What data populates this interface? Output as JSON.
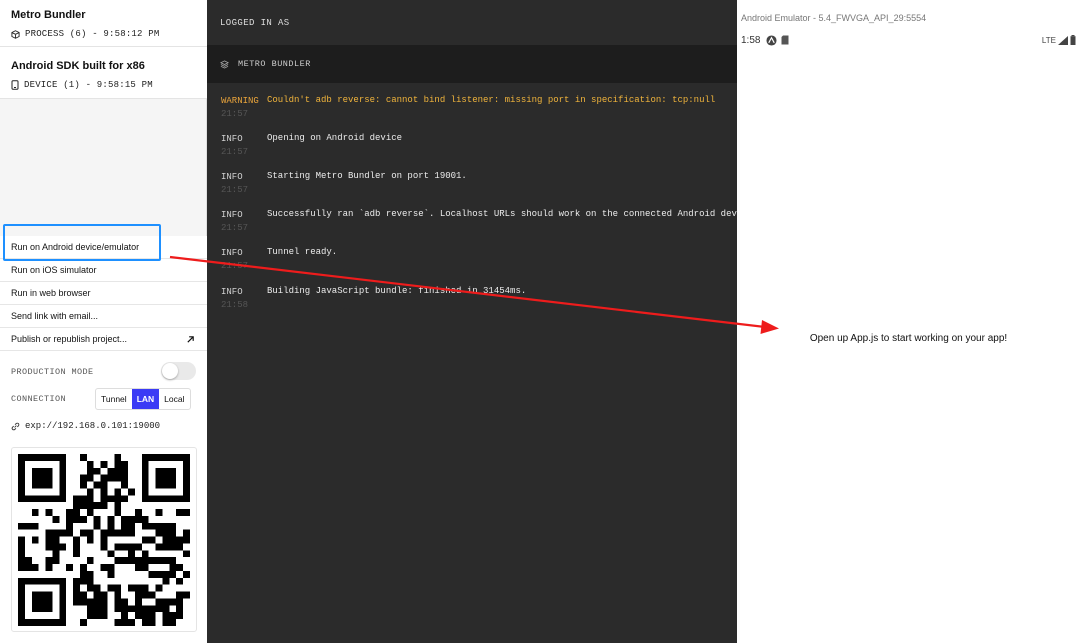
{
  "sidebar": {
    "processes": [
      {
        "title": "Metro Bundler",
        "subtitle": "PROCESS (6) - 9:58:12 PM"
      },
      {
        "title": "Android SDK built for x86",
        "subtitle": "DEVICE (1) - 9:58:15 PM"
      }
    ],
    "actions": [
      "Run on Android device/emulator",
      "Run on iOS simulator",
      "Run in web browser",
      "Send link with email...",
      "Publish or republish project..."
    ],
    "production_mode_label": "PRODUCTION MODE",
    "production_mode_on": false,
    "connection_label": "CONNECTION",
    "connection_options": [
      "Tunnel",
      "LAN",
      "Local"
    ],
    "connection_selected": "LAN",
    "exp_url": "exp://192.168.0.101:19000"
  },
  "logs": {
    "logged_in_label": "LOGGED IN AS",
    "panel_title": "METRO BUNDLER",
    "entries": [
      {
        "level": "WARNING",
        "time": "21:57",
        "message": "Couldn't adb reverse: cannot bind listener: missing port in specification: tcp:null"
      },
      {
        "level": "INFO",
        "time": "21:57",
        "message": "Opening on Android device"
      },
      {
        "level": "INFO",
        "time": "21:57",
        "message": "Starting Metro Bundler on port 19001."
      },
      {
        "level": "INFO",
        "time": "21:57",
        "message": "Successfully ran `adb reverse`. Localhost URLs should work on the connected Android device."
      },
      {
        "level": "INFO",
        "time": "21:57",
        "message": "Tunnel ready."
      },
      {
        "level": "INFO",
        "time": "21:58",
        "message": "Building JavaScript bundle: finished in 31454ms."
      }
    ]
  },
  "emulator": {
    "window_title": "Android Emulator - 5.4_FWVGA_API_29:5554",
    "status_time": "1:58",
    "network_label": "LTE",
    "app_text": "Open up App.js to start working on your app!"
  },
  "colors": {
    "accent": "#3b3bf5",
    "highlight": "#1e90ff",
    "arrow": "#ee1c1c",
    "warning": "#f0b43c",
    "log_bg": "#2b2b2b"
  }
}
